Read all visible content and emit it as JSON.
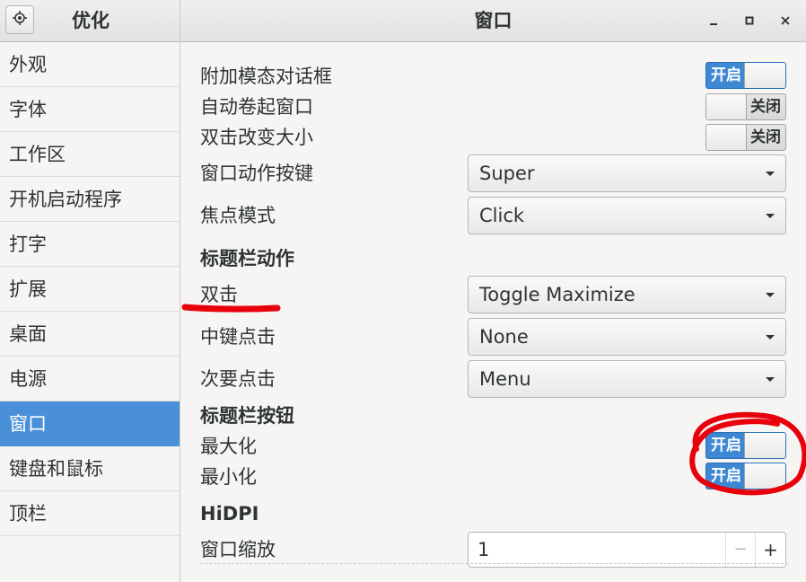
{
  "header": {
    "app_title": "优化",
    "window_title": "窗口",
    "menu_icon": "gear-icon",
    "controls": {
      "minimize": "–",
      "maximize": "□",
      "close": "✕"
    }
  },
  "sidebar": {
    "items": [
      {
        "label": "外观"
      },
      {
        "label": "字体"
      },
      {
        "label": "工作区"
      },
      {
        "label": "开机启动程序"
      },
      {
        "label": "打字"
      },
      {
        "label": "扩展"
      },
      {
        "label": "桌面"
      },
      {
        "label": "电源"
      },
      {
        "label": "窗口",
        "active": true
      },
      {
        "label": "键盘和鼠标"
      },
      {
        "label": "顶栏"
      }
    ]
  },
  "settings": {
    "attach_modal": {
      "label": "附加模态对话框",
      "state": "开启"
    },
    "auto_raise": {
      "label": "自动卷起窗口",
      "state": "关闭"
    },
    "double_click_resize": {
      "label": "双击改变大小",
      "state": "关闭"
    },
    "action_key": {
      "label": "窗口动作按键",
      "value": "Super"
    },
    "focus_mode": {
      "label": "焦点模式",
      "value": "Click"
    },
    "titlebar_actions_heading": "标题栏动作",
    "double_click": {
      "label": "双击",
      "value": "Toggle Maximize"
    },
    "middle_click": {
      "label": "中键点击",
      "value": "None"
    },
    "secondary_click": {
      "label": "次要点击",
      "value": "Menu"
    },
    "titlebar_buttons_heading": "标题栏按钮",
    "maximize": {
      "label": "最大化",
      "state": "开启"
    },
    "minimize": {
      "label": "最小化",
      "state": "开启"
    },
    "hidpi_heading": "HiDPI",
    "window_scale": {
      "label": "窗口缩放",
      "value": "1",
      "minus": "−",
      "plus": "+"
    }
  },
  "colors": {
    "accent": "#4a90d9",
    "annotation": "#e8000b"
  }
}
